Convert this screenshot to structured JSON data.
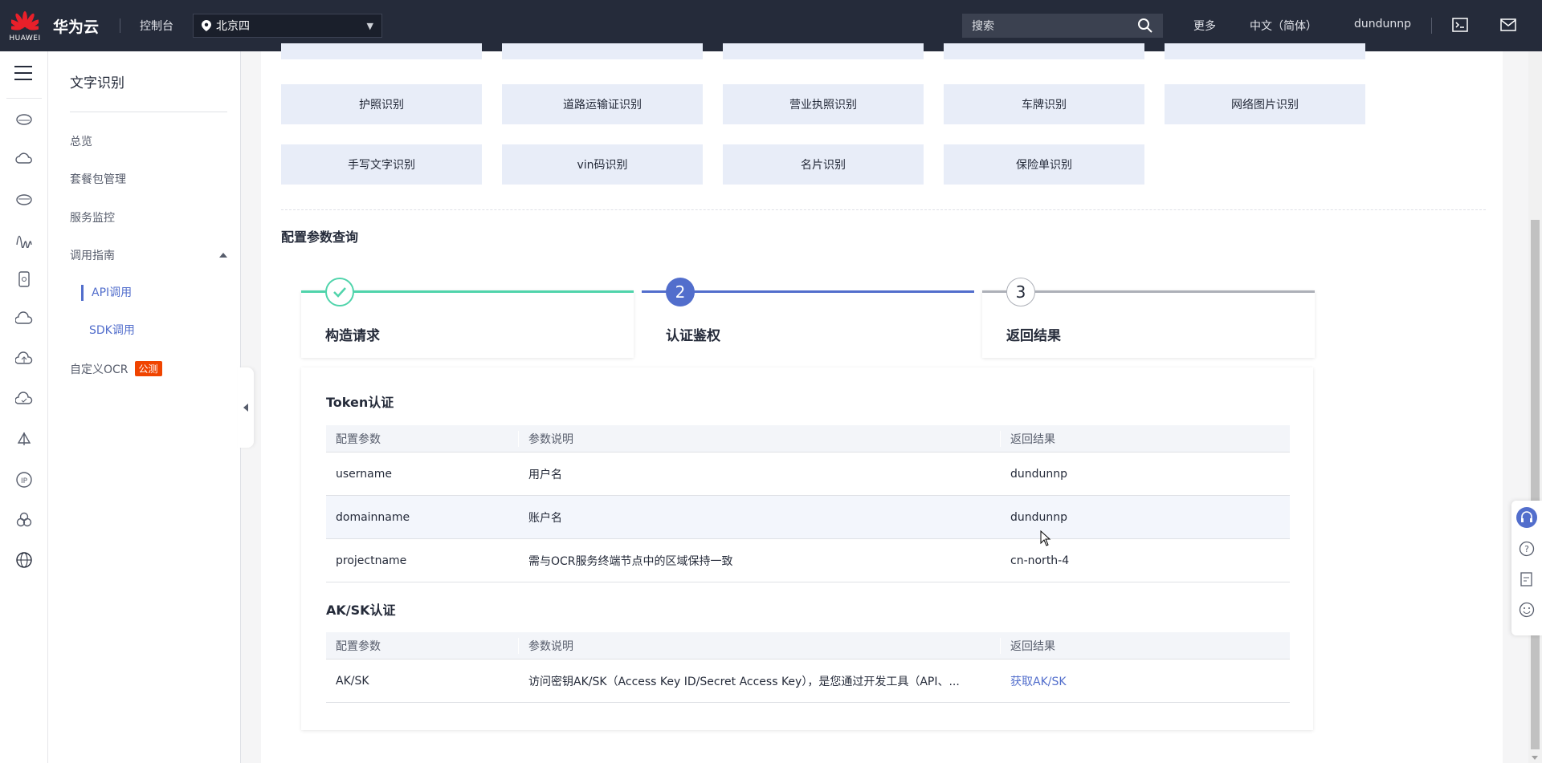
{
  "topnav": {
    "logo_text": "HUAWEI",
    "brand": "华为云",
    "console": "控制台",
    "region": "北京四",
    "search_placeholder": "搜索",
    "more": "更多",
    "language": "中文（简体）",
    "username": "dundunnp"
  },
  "sidebar": {
    "title": "文字识别",
    "items": {
      "overview": "总览",
      "packages": "套餐包管理",
      "monitor": "服务监控",
      "guide": "调用指南",
      "api": "API调用",
      "sdk": "SDK调用",
      "custom_ocr": "自定义OCR",
      "custom_ocr_badge": "公测"
    }
  },
  "services": {
    "row2": [
      "护照识别",
      "道路运输证识别",
      "营业执照识别",
      "车牌识别",
      "网络图片识别"
    ],
    "row3": [
      "手写文字识别",
      "vin码识别",
      "名片识别",
      "保险单识别"
    ]
  },
  "config": {
    "title": "配置参数查询",
    "steps": [
      {
        "label": "构造请求",
        "status": "done"
      },
      {
        "label": "认证鉴权",
        "number": "2",
        "status": "active"
      },
      {
        "label": "返回结果",
        "number": "3",
        "status": "pending"
      }
    ],
    "token": {
      "title": "Token认证",
      "headers": [
        "配置参数",
        "参数说明",
        "返回结果"
      ],
      "rows": [
        [
          "username",
          "用户名",
          "dundunnp"
        ],
        [
          "domainname",
          "账户名",
          "dundunnp"
        ],
        [
          "projectname",
          "需与OCR服务终端节点中的区域保持一致",
          "cn-north-4"
        ]
      ]
    },
    "aksk": {
      "title": "AK/SK认证",
      "headers": [
        "配置参数",
        "参数说明",
        "返回结果"
      ],
      "rows": [
        [
          "AK/SK",
          "访问密钥AK/SK（Access Key ID/Secret Access Key），是您通过开发工具（API、...",
          "获取AK/SK"
        ]
      ]
    }
  },
  "colors": {
    "topnav_bg": "#252b3a",
    "accent": "#526ecc",
    "done_green": "#50d4ab",
    "service_btn_bg": "#e8edf8",
    "badge": "#f04400"
  }
}
